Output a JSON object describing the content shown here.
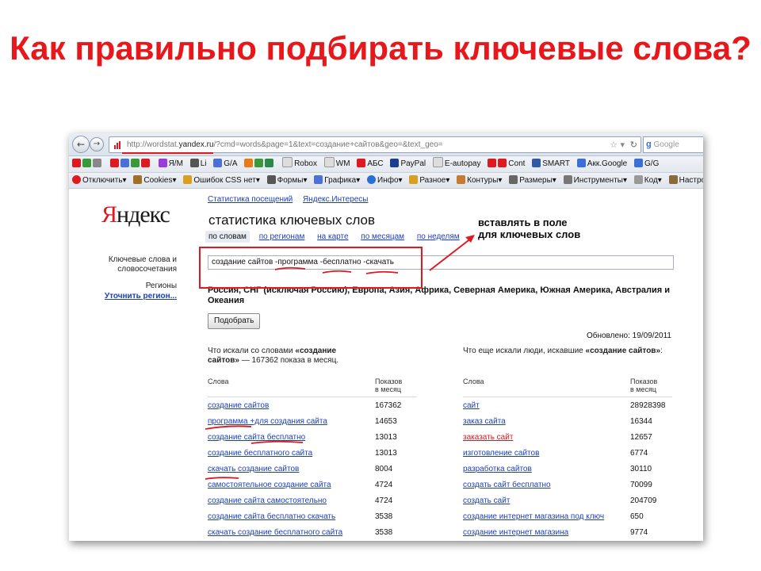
{
  "slide": {
    "title": "Как правильно подбирать ключевые слова?"
  },
  "browser": {
    "url_prefix": "http://wordstat.",
    "url_host": "yandex.ru",
    "url_rest": "/?cmd=words&page=1&text=создание+сайтов&geo=&text_geo=",
    "search_engine": "Google",
    "bookmarks": [
      "Я/М",
      "Li",
      "G/A",
      "Robox",
      "WM",
      "АБС",
      "PayPal",
      "E-autopay",
      "Cont",
      "SMART",
      "Акк.Google",
      "G/G"
    ],
    "toolbar": [
      "Отключить",
      "Cookies",
      "Ошибок CSS нет",
      "Формы",
      "Графика",
      "Инфо",
      "Разное",
      "Контуры",
      "Размеры",
      "Инструменты",
      "Код",
      "Настройки"
    ]
  },
  "page": {
    "logo": "Яндекс",
    "topnav": [
      "Статистика посещений",
      "Яндекс.Интересы"
    ],
    "title": "статистика ключевых слов",
    "tabs": [
      "по словам",
      "по регионам",
      "на карте",
      "по месяцам",
      "по неделям"
    ],
    "sidebar": {
      "keywords_label": "Ключевые слова и словосочетания",
      "regions_label": "Регионы",
      "regions_link": "Уточнить регион..."
    },
    "query_value": "создание сайтов -программа -бесплатно -скачать",
    "regions_text": "Россия, СНГ (исключая Россию), Европа, Азия, Африка, Северная Америка, Южная Америка, Австралия и Океания",
    "submit_label": "Подобрать",
    "updated": "Обновлено: 19/09/2011",
    "left": {
      "heading_pre": "Что искали со словами ",
      "heading_bold": "«создание сайтов»",
      "heading_post": " — 167362 показа в месяц.",
      "col_words": "Слова",
      "col_count_1": "Показов",
      "col_count_2": "в месяц",
      "rows": [
        {
          "w": "создание сайтов",
          "c": "167362"
        },
        {
          "w": "программа +для создания сайта",
          "c": "14653"
        },
        {
          "w": "создание сайта бесплатно",
          "c": "13013"
        },
        {
          "w": "создание бесплатного сайта",
          "c": "13013"
        },
        {
          "w": "скачать создание сайтов",
          "c": "8004"
        },
        {
          "w": "самостоятельное создание сайта",
          "c": "4724"
        },
        {
          "w": "создание сайта самостоятельно",
          "c": "4724"
        },
        {
          "w": "создание сайта бесплатно скачать",
          "c": "3538"
        },
        {
          "w": "скачать создание бесплатного сайта",
          "c": "3538"
        }
      ]
    },
    "right": {
      "heading_pre": "Что еще искали люди, искавшие ",
      "heading_bold": "«создание сайтов»",
      "heading_post": ":",
      "col_words": "Слова",
      "col_count_1": "Показов",
      "col_count_2": "в месяц",
      "rows": [
        {
          "w": "сайт",
          "c": "28928398"
        },
        {
          "w": "заказ сайта",
          "c": "16344"
        },
        {
          "w": "заказать сайт",
          "c": "12657"
        },
        {
          "w": "изготовление сайтов",
          "c": "6774"
        },
        {
          "w": "разработка сайтов",
          "c": "30110"
        },
        {
          "w": "создать сайт бесплатно",
          "c": "70099"
        },
        {
          "w": "создать сайт",
          "c": "204709"
        },
        {
          "w": "создание интернет магазина под ключ",
          "c": "650"
        },
        {
          "w": "создание интернет магазина",
          "c": "9774"
        }
      ]
    }
  },
  "annotation": {
    "line1": "вставлять в поле",
    "line2": "для ключевых слов",
    "color": "#e0181f"
  }
}
